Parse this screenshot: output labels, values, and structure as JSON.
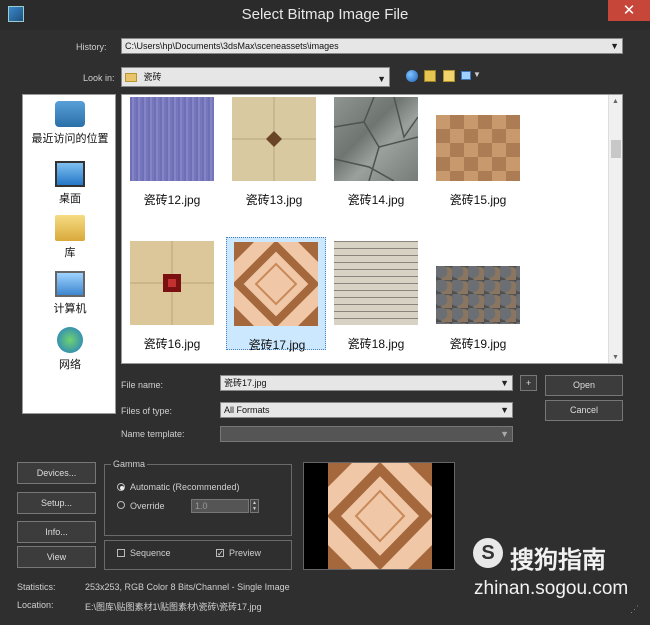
{
  "window": {
    "title": "Select Bitmap Image File",
    "close_glyph": "✕"
  },
  "history": {
    "label": "History:",
    "value": "C:\\Users\\hp\\Documents\\3dsMax\\sceneassets\\images"
  },
  "lookin": {
    "label": "Look in:",
    "value": "瓷砖"
  },
  "places": [
    {
      "label": "最近访问的位置",
      "icon": "recent-places-icon"
    },
    {
      "label": "桌面",
      "icon": "desktop-icon"
    },
    {
      "label": "库",
      "icon": "libraries-icon"
    },
    {
      "label": "计算机",
      "icon": "computer-icon"
    },
    {
      "label": "网络",
      "icon": "network-icon"
    }
  ],
  "files": [
    {
      "name": "瓷砖12.jpg",
      "selected": false
    },
    {
      "name": "瓷砖13.jpg",
      "selected": false
    },
    {
      "name": "瓷砖14.jpg",
      "selected": false
    },
    {
      "name": "瓷砖15.jpg",
      "selected": false
    },
    {
      "name": "瓷砖16.jpg",
      "selected": false
    },
    {
      "name": "瓷砖17.jpg",
      "selected": true
    },
    {
      "name": "瓷砖18.jpg",
      "selected": false
    },
    {
      "name": "瓷砖19.jpg",
      "selected": false
    }
  ],
  "filename": {
    "label": "File name:",
    "value": "瓷砖17.jpg",
    "plus": "+"
  },
  "filetype": {
    "label": "Files of type:",
    "value": "All Formats"
  },
  "nametemplate": {
    "label": "Name template:",
    "value": ""
  },
  "buttons": {
    "open": "Open",
    "cancel": "Cancel",
    "devices": "Devices...",
    "setup": "Setup...",
    "info": "Info...",
    "view": "View"
  },
  "gamma": {
    "title": "Gamma",
    "automatic": "Automatic (Recommended)",
    "override": "Override",
    "override_value": "1.0"
  },
  "options": {
    "sequence": "Sequence",
    "preview": "Preview",
    "sequence_checked": false,
    "preview_checked": true
  },
  "statistics": {
    "label": "Statistics:",
    "value": "253x253, RGB Color 8 Bits/Channel - Single Image"
  },
  "location": {
    "label": "Location:",
    "value": "E:\\图库\\贴图素材1\\贴图素材\\瓷砖\\瓷砖17.jpg"
  },
  "watermark": {
    "brand": "搜狗指南",
    "url": "zhinan.sogou.com"
  },
  "colors": {
    "background": "#2f2f2f",
    "selection": "#cce8ff",
    "close": "#c7463a"
  }
}
